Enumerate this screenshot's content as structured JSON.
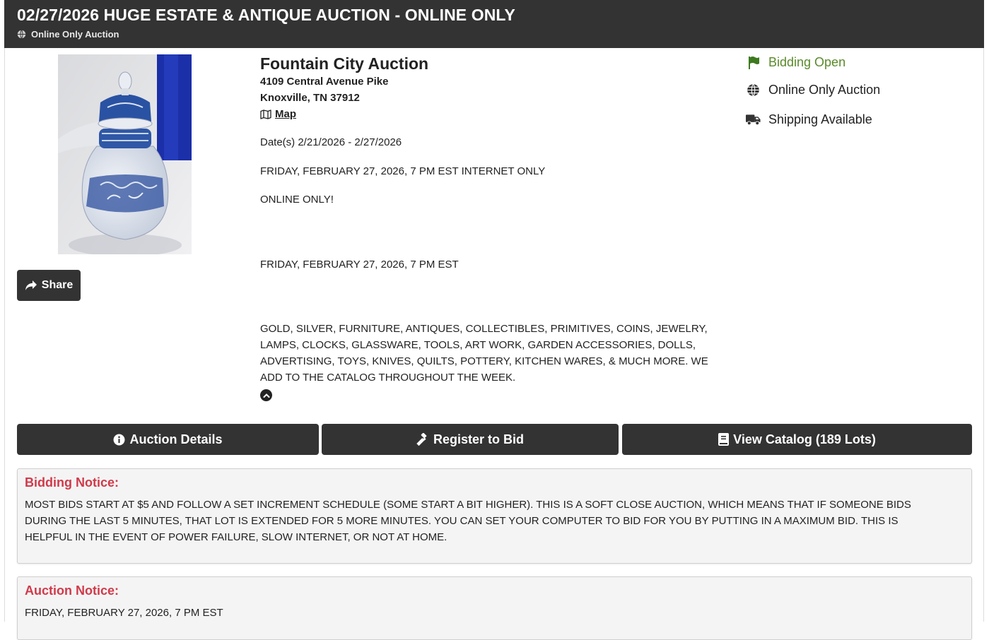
{
  "header": {
    "title": "02/27/2026 HUGE ESTATE & ANTIQUE AUCTION - ONLINE ONLY",
    "subtitle": "Online Only Auction",
    "subtitle_icon": "globe-icon"
  },
  "share": {
    "label": "Share",
    "icon": "share-icon"
  },
  "auctioneer": {
    "name": "Fountain City Auction",
    "address_line1": "4109 Central Avenue Pike",
    "address_line2": "Knoxville, TN 37912",
    "map_label": "Map",
    "map_icon": "map-icon"
  },
  "details": {
    "dates": "Date(s) 2/21/2026 - 2/27/2026",
    "line1": "FRIDAY, FEBRUARY 27, 2026, 7 PM EST INTERNET ONLY",
    "line2": "ONLINE ONLY!",
    "line3": "FRIDAY, FEBRUARY 27, 2026, 7 PM EST",
    "description_lines": [
      "GOLD, SILVER, FURNITURE, ANTIQUES, COLLECTIBLES, PRIMITIVES, COINS, JEWELRY,",
      "LAMPS, CLOCKS, GLASSWARE, TOOLS, ART WORK, GARDEN ACCESSORIES, DOLLS,",
      "ADVERTISING, TOYS, KNIVES, QUILTS, POTTERY, KITCHEN WARES, & MUCH MORE. WE",
      "ADD TO THE CATALOG THROUGHOUT THE WEEK."
    ],
    "collapse_icon": "chevron-up-icon"
  },
  "status": {
    "bidding": {
      "label": "Bidding Open",
      "icon": "flag-icon",
      "color": "#5a8a2a"
    },
    "online": {
      "label": "Online Only Auction",
      "icon": "globe-icon"
    },
    "shipping": {
      "label": "Shipping Available",
      "icon": "truck-icon"
    }
  },
  "actions": {
    "details": {
      "label": "Auction Details",
      "icon": "info-icon"
    },
    "register": {
      "label": "Register to Bid",
      "icon": "gavel-icon"
    },
    "catalog": {
      "label": "View Catalog (189 Lots)",
      "icon": "book-icon"
    }
  },
  "bidding_notice": {
    "title": "Bidding Notice:",
    "lines": [
      "MOST BIDS START AT $5 AND FOLLOW A SET INCREMENT SCHEDULE (SOME START A BIT HIGHER). THIS IS A SOFT CLOSE AUCTION, WHICH MEANS THAT IF SOMEONE BIDS",
      "DURING THE LAST 5 MINUTES, THAT LOT IS EXTENDED FOR 5 MORE MINUTES. YOU CAN SET YOUR COMPUTER TO BID FOR YOU BY PUTTING IN A MAXIMUM BID. THIS IS",
      "HELPFUL IN THE EVENT OF POWER FAILURE, SLOW INTERNET, OR NOT AT HOME."
    ]
  },
  "auction_notice": {
    "title": "Auction Notice:",
    "body": "FRIDAY, FEBRUARY 27, 2026, 7 PM EST"
  },
  "colors": {
    "header_bg": "#333333",
    "notice_title": "#d03a4a",
    "status_green": "#5a8a2a"
  }
}
